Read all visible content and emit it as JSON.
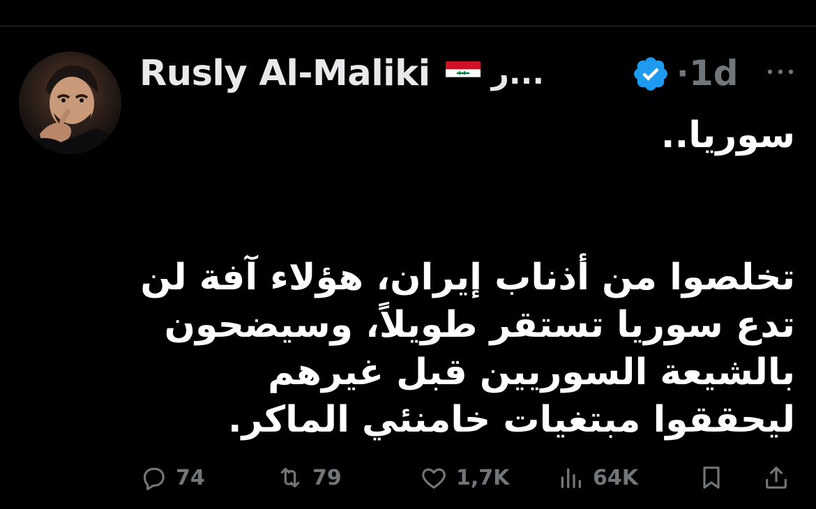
{
  "tweet": {
    "author": {
      "display_name": "Rusly Al-Maliki",
      "handle": "ر...",
      "verified": true
    },
    "separator": "·",
    "time": "1d",
    "text": "سوريا..\n\n\nتخلصوا من أذناب إيران، هؤلاء آفة لن تدع سوريا تستقر طويلاً، وسيضحون بالشيعة السوريين قبل غيرهم ليحققوا مبتغيات خامنئي الماكر."
  },
  "actions": {
    "replies": "74",
    "retweets": "79",
    "likes": "1,7K",
    "views": "64K"
  },
  "icons": {
    "reply": "reply-icon",
    "retweet": "retweet-icon",
    "like": "heart-icon",
    "views": "views-icon",
    "bookmark": "bookmark-icon",
    "share": "share-icon",
    "more": "more-icon",
    "verified": "verified-badge-icon",
    "flag": "iraq-flag-icon"
  },
  "colors": {
    "background": "#000000",
    "text": "#e7e9ea",
    "muted": "#71767b",
    "verified": "#1d9bf0"
  }
}
